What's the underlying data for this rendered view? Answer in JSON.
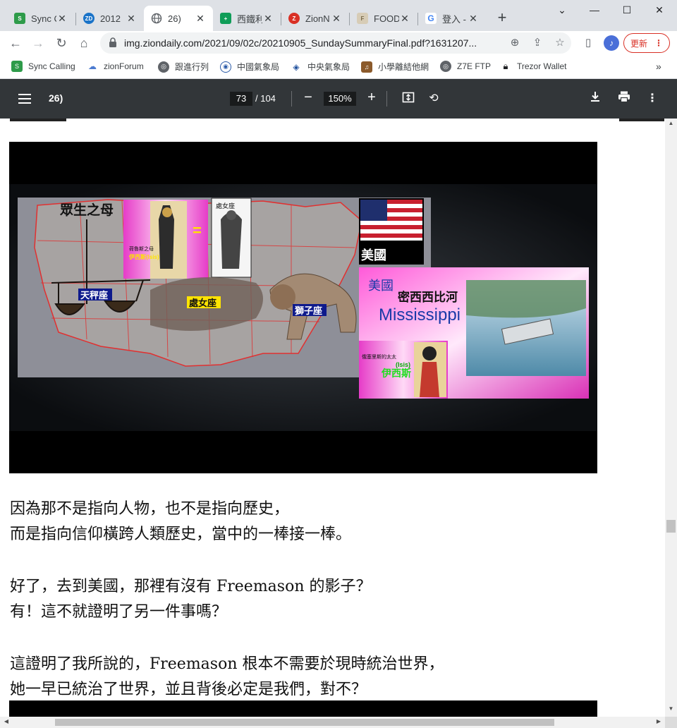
{
  "tabs": [
    {
      "title": "Sync C",
      "favicon_color": "#2e9b4a",
      "favicon_text": "S"
    },
    {
      "title": "2012",
      "favicon_color": "#1a73c8",
      "favicon_text": "ZD"
    },
    {
      "title": "26)",
      "favicon_color": "#5f6368",
      "favicon_text": ""
    },
    {
      "title": "西鐵利",
      "favicon_color": "#0f9d58",
      "favicon_text": "+"
    },
    {
      "title": "ZionN",
      "favicon_color": "#d93025",
      "favicon_text": "Z"
    },
    {
      "title": "FOOD",
      "favicon_color": "#c8b89a",
      "favicon_text": "F"
    },
    {
      "title": "登入 -",
      "favicon_color": "#ffffff",
      "favicon_text": "G"
    }
  ],
  "window": {
    "minimize": "⌄",
    "min2": "—",
    "max": "☐",
    "close": "✕"
  },
  "address": {
    "url": "img.ziondaily.com/2021/09/02c/20210905_SundaySummaryFinal.pdf?1631207...",
    "update_label": "更新"
  },
  "bookmarks": [
    {
      "label": "Sync Calling",
      "color": "#2e9b4a"
    },
    {
      "label": "zionForum",
      "color": "#4c7bd0"
    },
    {
      "label": "跟進行列",
      "color": "#5f6368"
    },
    {
      "label": "中國氣象局",
      "color": "#2a5aa8"
    },
    {
      "label": "中央氣象局",
      "color": "#1e4f9c"
    },
    {
      "label": "小學離結他網",
      "color": "#8b5a2b"
    },
    {
      "label": "Z7E FTP",
      "color": "#5f6368"
    },
    {
      "label": "Trezor Wallet",
      "color": "#202124"
    }
  ],
  "pdf": {
    "title": "26)",
    "page": "73",
    "total": "/ 104",
    "zoom": "150%"
  },
  "slide": {
    "map_title": "眾生之母",
    "libra": "天秤座",
    "virgo": "處女座",
    "virgo_top": "處女座",
    "leo": "獅子座",
    "isis_small": "荷魯斯之母",
    "isis_name": "伊西斯(Isis)",
    "equals": "=",
    "usa": "美國",
    "panel_usa": "美國",
    "panel_river": "密西西比河",
    "panel_mississippi": "Mississippi",
    "isis2_small": "俄塞里斯的太太",
    "isis2_en": "(Isis)",
    "isis2_name": "伊西斯"
  },
  "text": {
    "p1_l1": "因為那不是指向人物，也不是指向歷史，",
    "p1_l2": "而是指向信仰橫跨人類歷史，當中的一棒接一棒。",
    "p2_l1": "好了，去到美國，那裡有沒有 Freemason 的影子？",
    "p2_l2": "有！這不就證明了另一件事嗎？",
    "p3_l1": "這證明了我所說的，Freemason 根本不需要於現時統治世界，",
    "p3_l2": "她一早已統治了世界，並且背後必定是我們，對不？"
  }
}
